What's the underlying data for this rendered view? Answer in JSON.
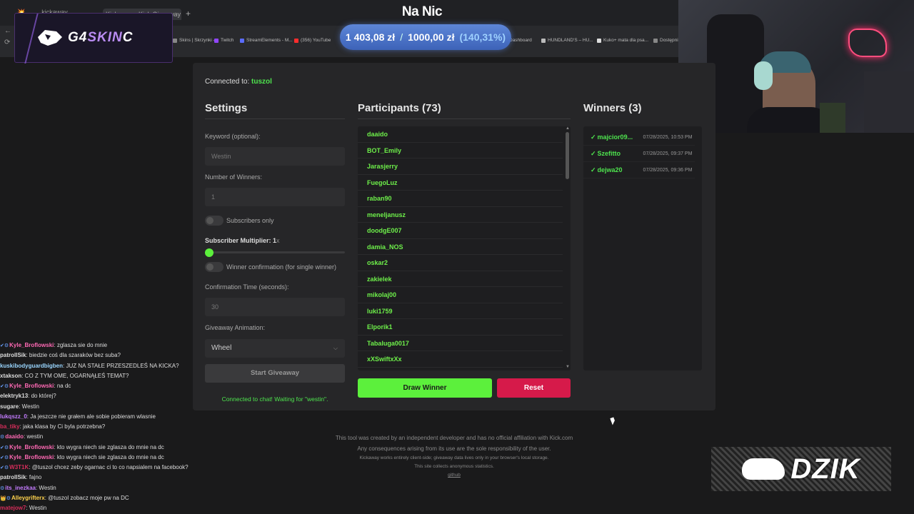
{
  "browser": {
    "tabs": [
      "💥 …… kickaway",
      "Kickaway - Kick Giveaway Tool"
    ],
    "bookmarks": [
      {
        "label": "Skins | Skrzynki -...",
        "color": "#888888"
      },
      {
        "label": "Twitch",
        "color": "#9146ff"
      },
      {
        "label": "StreamElements - M...",
        "color": "#5a6cff"
      },
      {
        "label": "(356) YouTube",
        "color": "#ff2d2d"
      },
      {
        "label": "Dashboard",
        "color": "#888888"
      },
      {
        "label": "HUNDLAND'S – HU...",
        "color": "#bbbbbb"
      },
      {
        "label": "Kuko+ mata dla psa...",
        "color": "#dddddd"
      },
      {
        "label": "Dostępni s",
        "color": "#888888"
      }
    ]
  },
  "overlay": {
    "logo_part1": "G4",
    "logo_part2": "SKIN",
    "logo_part3": "C",
    "stream_title": "Na Nic",
    "money_current": "1 403,08 zł",
    "money_sep": "/",
    "money_goal": "1000,00 zł",
    "money_pct": "(140,31%)",
    "dzik": "DZIK"
  },
  "app": {
    "connected_label": "Connected to:",
    "connected_user": "tuszol",
    "settings": {
      "title": "Settings",
      "keyword_label": "Keyword (optional):",
      "keyword_value": "Westin",
      "winners_label": "Number of Winners:",
      "winners_value": "1",
      "subs_only_label": "Subscribers only",
      "multiplier_label": "Subscriber Multiplier: 1",
      "multiplier_suffix": "x",
      "multiplier_fraction": 0.0,
      "confirm_label": "Winner confirmation (for single winner)",
      "confirm_time_label": "Confirmation Time (seconds):",
      "confirm_time_value": "30",
      "animation_label": "Giveaway Animation:",
      "animation_value": "Wheel",
      "start_button": "Start Giveaway",
      "status": "Connected to chat! Waiting for \"westin\"."
    },
    "participants": {
      "title": "Participants (73)",
      "items": [
        "daaido",
        "BOT_Emily",
        "Jarasjerry",
        "FuegoLuz",
        "raban90",
        "meneljanusz",
        "doodgE007",
        "damia_NOS",
        "oskar2",
        "zakielek",
        "mikolaj00",
        "luki1759",
        "Elporik1",
        "Tabaluga0017",
        "xXSwiftxXx"
      ],
      "draw_button": "Draw Winner",
      "reset_button": "Reset"
    },
    "winners": {
      "title": "Winners (3)",
      "items": [
        {
          "name": "majcior09...",
          "time": "07/28/2025, 10:53 PM"
        },
        {
          "name": "Szefitto",
          "time": "07/28/2025, 09:37 PM"
        },
        {
          "name": "dejwa20",
          "time": "07/28/2025, 09:36 PM"
        }
      ]
    },
    "footer": [
      "This tool was created by an independent developer and has no official affiliation with Kick.com",
      "Any consequences arising from its use are the sole responsibility of the user.",
      "Kickaway works entirely client-side; giveaway data lives only in your browser's local storage.",
      "This site collects anonymous statistics.",
      "github"
    ]
  },
  "chat": [
    {
      "badge": "✔⚙",
      "user": "Kyle_Broflowski",
      "color": "#ff69b4",
      "text": ": zglasza sie do mnie"
    },
    {
      "badge": "",
      "user": "patrollSik",
      "color": "#dddddd",
      "text": ": biedzie coś dla szaraków bez suba?"
    },
    {
      "badge": "",
      "user": "kuskibodyguardbigben",
      "color": "#9ad6ff",
      "text": ": JUZ NA STAŁE PRZESZEDLEŚ NA KICKA?"
    },
    {
      "badge": "",
      "user": "xtakson",
      "color": "#dddddd",
      "text": ": CO Z TYM OME, OGARNĄŁEŚ TEMAT?"
    },
    {
      "badge": "✔⚙",
      "user": "Kyle_Broflowski",
      "color": "#ff69b4",
      "text": ": na dc"
    },
    {
      "badge": "",
      "user": "elektryk13",
      "color": "#dddddd",
      "text": ": do której?"
    },
    {
      "badge": "",
      "user": "sugare",
      "color": "#dddddd",
      "text": ": Westin"
    },
    {
      "badge": "",
      "user": "lukqszz_0",
      "color": "#c47cff",
      "text": ": Ja jeszcze nie grałem ale sobie pobieram wlasnie"
    },
    {
      "badge": "",
      "user": "ba_tiky",
      "color": "#d62d5a",
      "text": ": jaka klasa by Ci byla potrzebna?"
    },
    {
      "badge": "⚙",
      "user": "daaido",
      "color": "#ff69b4",
      "text": ": westin"
    },
    {
      "badge": "✔⚙",
      "user": "Kyle_Broflowski",
      "color": "#ff69b4",
      "text": ": kto wygra niech sie zglasza do mnie na dc"
    },
    {
      "badge": "✔⚙",
      "user": "Kyle_Broflowski",
      "color": "#ff69b4",
      "text": ": kto wygra niech sie zglasza do mnie na dc"
    },
    {
      "badge": "✔⚙",
      "user": "W3T1K",
      "color": "#d62d5a",
      "text": ": @tuszol chcez zeby ogarnac ci to co napsialem na facebook?"
    },
    {
      "badge": "",
      "user": "patrollSik",
      "color": "#dddddd",
      "text": ": fajno"
    },
    {
      "badge": "⚙",
      "user": "its_inezkaa",
      "color": "#c47cff",
      "text": ": Westin"
    },
    {
      "badge": "👑⚙",
      "user": "Alleygrifterx",
      "color": "#ffd34e",
      "text": ": @tuszol zobacz moje pw na DC"
    },
    {
      "badge": "",
      "user": "matejow7",
      "color": "#d62d5a",
      "text": ": Westin"
    }
  ]
}
